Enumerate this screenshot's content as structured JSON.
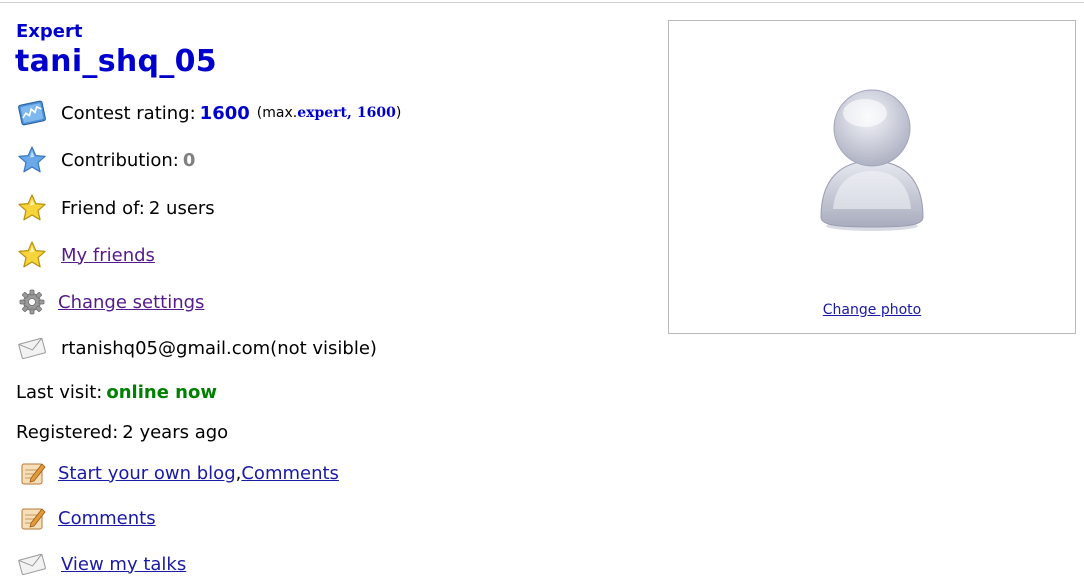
{
  "profile": {
    "rank": "Expert",
    "handle": "tani_shq_05",
    "rating": {
      "label": "Contest rating: ",
      "value": "1600",
      "max_prefix": "(max. ",
      "max_rank": "expert,",
      "max_value": "1600",
      "max_suffix": ")"
    },
    "contribution": {
      "label": "Contribution: ",
      "value": "0"
    },
    "friend_of": {
      "label": "Friend of: ",
      "value": "2 users"
    },
    "my_friends": "My friends",
    "change_settings": "Change settings",
    "email": {
      "address": "rtanishq05@gmail.com",
      "visibility": " (not visible)"
    },
    "last_visit": {
      "label": "Last visit: ",
      "value": "online now"
    },
    "registered": {
      "label": "Registered: ",
      "value": "2 years ago"
    },
    "blog": {
      "start": "Start your own blog",
      "separator": ", ",
      "comments": "Comments"
    },
    "comments": "Comments",
    "talks": "View my talks"
  },
  "photo": {
    "change_label": "Change photo"
  },
  "icons": {
    "rating": "rating-chart-icon",
    "contribution": "blue-star-icon",
    "friend_of": "gold-star-icon",
    "my_friends": "gold-star-icon",
    "settings": "gear-icon",
    "email": "envelope-icon",
    "blog": "blog-notepad-icon",
    "comments": "blog-notepad-icon",
    "talks": "envelope-icon",
    "avatar": "default-user-avatar"
  },
  "colors": {
    "rank_blue": "#0000cc",
    "online_green": "#008000",
    "contribution_grey": "#808080",
    "link": "#1a1aa6",
    "visited_link": "#551a8b"
  }
}
